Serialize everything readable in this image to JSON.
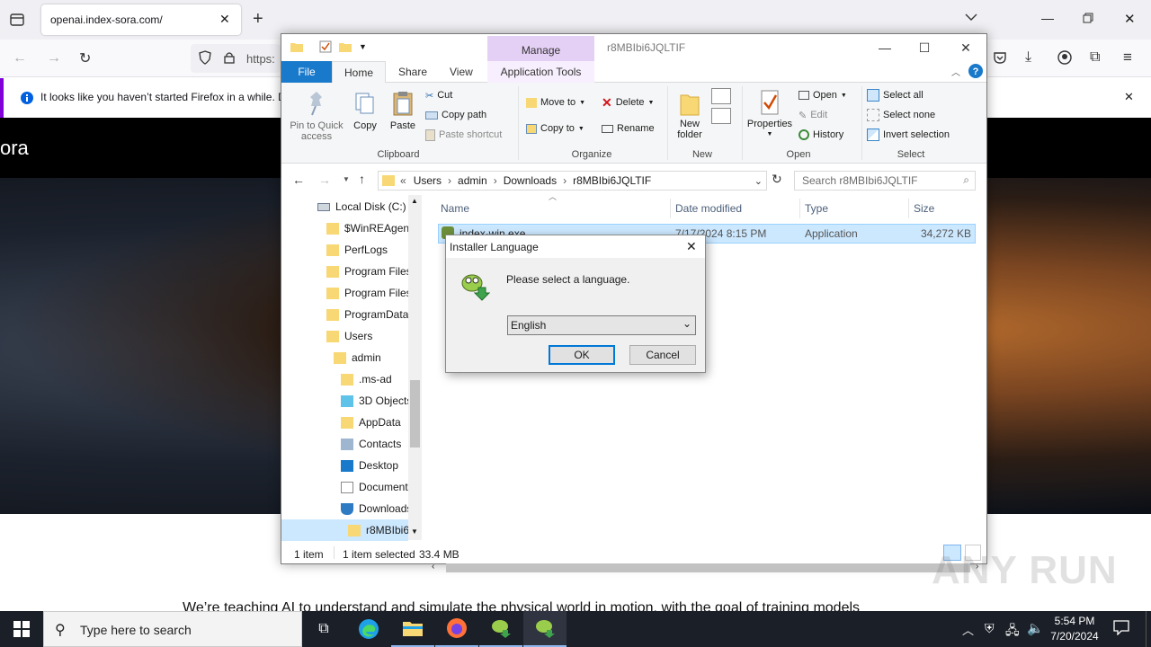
{
  "browser": {
    "tab_title": "openai.index-sora.com/",
    "url_partial": "https:",
    "notice_text": "It looks like you haven’t started Firefox in a while. D"
  },
  "page": {
    "logo_text": "ora",
    "tagline": "We’re teaching AI to understand and simulate the physical world in motion, with the goal of training models"
  },
  "explorer": {
    "title": "r8MBIbi6JQLTIF",
    "manage_label": "Manage",
    "tabs": {
      "file": "File",
      "home": "Home",
      "share": "Share",
      "view": "View",
      "app_tools": "Application Tools"
    },
    "clipboard": {
      "pin": "Pin to Quick access",
      "copy": "Copy",
      "paste": "Paste",
      "cut": "Cut",
      "copy_path": "Copy path",
      "paste_shortcut": "Paste shortcut",
      "label": "Clipboard"
    },
    "organize": {
      "move_to": "Move to",
      "copy_to": "Copy to",
      "delete": "Delete",
      "rename": "Rename",
      "label": "Organize"
    },
    "new": {
      "new_folder": "New folder",
      "label": "New"
    },
    "open": {
      "properties": "Properties",
      "open": "Open",
      "edit": "Edit",
      "history": "History",
      "label": "Open"
    },
    "select": {
      "select_all": "Select all",
      "select_none": "Select none",
      "invert": "Invert selection",
      "label": "Select"
    },
    "breadcrumb": [
      "Users",
      "admin",
      "Downloads",
      "r8MBIbi6JQLTIF"
    ],
    "search_placeholder": "Search r8MBIbi6JQLTIF",
    "nav": [
      {
        "label": "Local Disk (C:)",
        "icon": "drive-icon"
      },
      {
        "label": "$WinREAgent",
        "icon": "folder-icon"
      },
      {
        "label": "PerfLogs",
        "icon": "folder-icon"
      },
      {
        "label": "Program Files",
        "icon": "folder-icon"
      },
      {
        "label": "Program Files",
        "icon": "folder-icon"
      },
      {
        "label": "ProgramData",
        "icon": "folder-icon"
      },
      {
        "label": "Users",
        "icon": "folder-icon"
      },
      {
        "label": "admin",
        "icon": "folder-icon"
      },
      {
        "label": ".ms-ad",
        "icon": "folder-icon"
      },
      {
        "label": "3D Objects",
        "icon": "cube-icon"
      },
      {
        "label": "AppData",
        "icon": "folder-icon"
      },
      {
        "label": "Contacts",
        "icon": "contacts-icon"
      },
      {
        "label": "Desktop",
        "icon": "desktop-icon"
      },
      {
        "label": "Documents",
        "icon": "document-icon"
      },
      {
        "label": "Downloads",
        "icon": "download-icon"
      },
      {
        "label": "r8MBIbi6",
        "icon": "folder-icon"
      }
    ],
    "columns": {
      "name": "Name",
      "date": "Date modified",
      "type": "Type",
      "size": "Size"
    },
    "file": {
      "name": "index-win.exe",
      "date": "7/17/2024 8:15 PM",
      "type": "Application",
      "size": "34,272 KB"
    },
    "status": {
      "count": "1 item",
      "selected": "1 item selected",
      "size": "33.4 MB"
    }
  },
  "dialog": {
    "title": "Installer Language",
    "message": "Please select a language.",
    "selected_language": "English",
    "ok": "OK",
    "cancel": "Cancel"
  },
  "taskbar": {
    "search_placeholder": "Type here to search",
    "time": "5:54 PM",
    "date": "7/20/2024"
  },
  "watermark": "ANY RUN"
}
